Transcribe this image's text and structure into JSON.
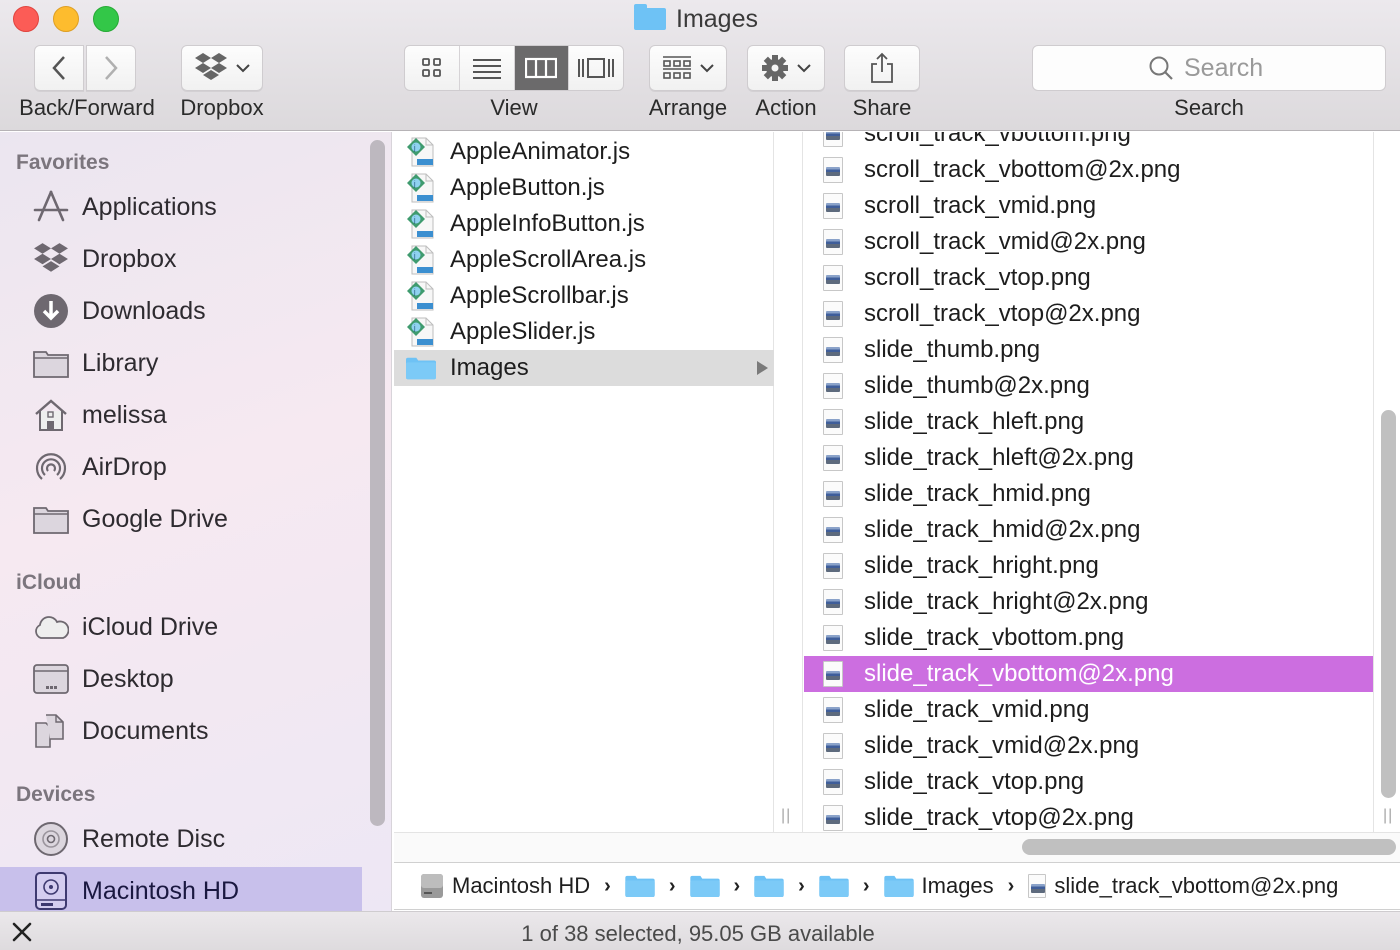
{
  "window": {
    "title": "Images",
    "title_icon": "folder-icon"
  },
  "toolbar": {
    "back_forward_label": "Back/Forward",
    "dropbox_label": "Dropbox",
    "view_label": "View",
    "view_modes": [
      {
        "name": "icon-view",
        "icon": "grid-icon",
        "active": false
      },
      {
        "name": "list-view",
        "icon": "list-icon",
        "active": false
      },
      {
        "name": "column-view",
        "icon": "columns-icon",
        "active": true
      },
      {
        "name": "cover-flow-view",
        "icon": "coverflow-icon",
        "active": false
      }
    ],
    "arrange_label": "Arrange",
    "action_label": "Action",
    "share_label": "Share",
    "search_placeholder": "Search",
    "search_value": "",
    "search_label": "Search"
  },
  "sidebar": {
    "sections": [
      {
        "heading": "Favorites",
        "items": [
          {
            "label": "Applications",
            "icon": "applications-icon"
          },
          {
            "label": "Dropbox",
            "icon": "dropbox-icon"
          },
          {
            "label": "Downloads",
            "icon": "downloads-icon"
          },
          {
            "label": "Library",
            "icon": "folder-icon"
          },
          {
            "label": "melissa",
            "icon": "home-icon"
          },
          {
            "label": "AirDrop",
            "icon": "airdrop-icon"
          },
          {
            "label": "Google Drive",
            "icon": "folder-icon"
          }
        ]
      },
      {
        "heading": "iCloud",
        "items": [
          {
            "label": "iCloud Drive",
            "icon": "cloud-icon"
          },
          {
            "label": "Desktop",
            "icon": "desktop-icon"
          },
          {
            "label": "Documents",
            "icon": "documents-icon"
          }
        ]
      },
      {
        "heading": "Devices",
        "items": [
          {
            "label": "Remote Disc",
            "icon": "disc-icon"
          },
          {
            "label": "Macintosh HD",
            "icon": "hard-drive-icon",
            "selected": true
          }
        ]
      }
    ]
  },
  "column1": {
    "items": [
      {
        "name": "AppleAnimator.js",
        "type": "js"
      },
      {
        "name": "AppleButton.js",
        "type": "js"
      },
      {
        "name": "AppleInfoButton.js",
        "type": "js"
      },
      {
        "name": "AppleScrollArea.js",
        "type": "js"
      },
      {
        "name": "AppleScrollbar.js",
        "type": "js"
      },
      {
        "name": "AppleSlider.js",
        "type": "js"
      },
      {
        "name": "Images",
        "type": "folder",
        "open": true
      }
    ]
  },
  "column2": {
    "items": [
      {
        "name": "scroll_track_vbottom.png"
      },
      {
        "name": "scroll_track_vbottom@2x.png"
      },
      {
        "name": "scroll_track_vmid.png"
      },
      {
        "name": "scroll_track_vmid@2x.png"
      },
      {
        "name": "scroll_track_vtop.png"
      },
      {
        "name": "scroll_track_vtop@2x.png"
      },
      {
        "name": "slide_thumb.png"
      },
      {
        "name": "slide_thumb@2x.png"
      },
      {
        "name": "slide_track_hleft.png"
      },
      {
        "name": "slide_track_hleft@2x.png"
      },
      {
        "name": "slide_track_hmid.png"
      },
      {
        "name": "slide_track_hmid@2x.png"
      },
      {
        "name": "slide_track_hright.png"
      },
      {
        "name": "slide_track_hright@2x.png"
      },
      {
        "name": "slide_track_vbottom.png"
      },
      {
        "name": "slide_track_vbottom@2x.png",
        "selected": true
      },
      {
        "name": "slide_track_vmid.png"
      },
      {
        "name": "slide_track_vmid@2x.png"
      },
      {
        "name": "slide_track_vtop.png"
      },
      {
        "name": "slide_track_vtop@2x.png"
      }
    ]
  },
  "pathbar": {
    "crumbs": [
      {
        "label": "Macintosh HD",
        "icon": "hard-drive-icon"
      },
      {
        "label": "",
        "icon": "applications-folder-icon"
      },
      {
        "label": "",
        "icon": "library-folder-icon"
      },
      {
        "label": "",
        "icon": "folder-icon"
      },
      {
        "label": "",
        "icon": "folder-icon"
      },
      {
        "label": "Images",
        "icon": "folder-icon"
      },
      {
        "label": "slide_track_vbottom@2x.png",
        "icon": "png-file-icon"
      }
    ]
  },
  "status": {
    "text": "1 of 38 selected, 95.05 GB available"
  },
  "colors": {
    "selection_accent": "#cc6ee0",
    "sidebar_selection": "#c8c0eb",
    "folder_blue": "#6ec2f5"
  }
}
